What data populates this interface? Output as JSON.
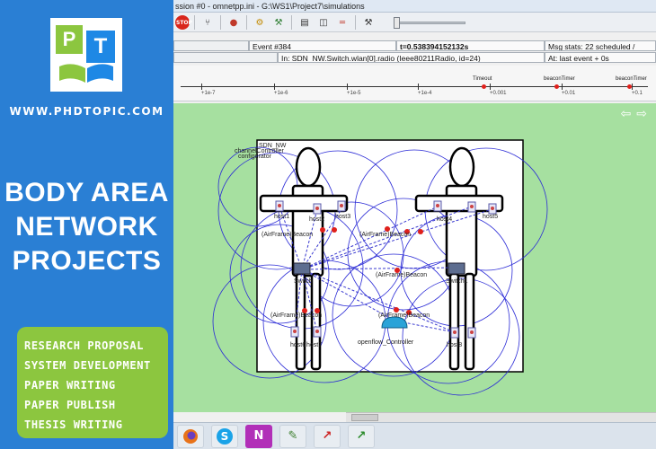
{
  "promo": {
    "logo_p": "P",
    "logo_t": "T",
    "website": "WWW.PHDTOPIC.COM",
    "title_lines": [
      "BODY AREA",
      "NETWORK",
      "PROJECTS"
    ],
    "services": [
      "RESEARCH PROPOSAL",
      "SYSTEM DEVELOPMENT",
      "PAPER WRITING",
      "PAPER PUBLISH",
      "THESIS WRITING"
    ],
    "colors": {
      "panel": "#2a7fd4",
      "green": "#8cc63f"
    }
  },
  "window": {
    "title": "ssion #0 - omnetpp.ini - G:\\WS1\\Project7\\simulations",
    "toolbar_icons": [
      "stop-icon",
      "step-icon",
      "record-icon",
      "run-icon",
      "fast-run-icon",
      "view-module-icon",
      "view-split-icon",
      "timeline-icon",
      "wrench-icon"
    ],
    "stop_label": "STOP",
    "rec_label": "REC",
    "event_label": "Event #384",
    "time_label": "t=0.538394152132s",
    "msg_stats": "Msg stats: 22 scheduled /",
    "module_path": "In: SDN_NW.Switch.wlan[0].radio (Ieee80211Radio, id=24)",
    "last_event": "At: last event + 0s",
    "timeline": {
      "events": [
        "Timeout",
        "beaconTimer",
        "beaconTimer"
      ],
      "scale_labels": [
        "+1e-7",
        "+1e-6",
        "+1e-5",
        "+1e-4",
        "+0.001",
        "+0.01",
        "+0.1"
      ]
    },
    "nav_arrows": "⇦⇨"
  },
  "network": {
    "name": "SDN_NW",
    "bg_label": "channelController",
    "config_label": "configurator",
    "hosts": [
      "host1",
      "host2",
      "host3",
      "host4",
      "host5",
      "host6",
      "host7",
      "host8"
    ],
    "beacon_label": "(AirFrame)Beacon",
    "switch1": "Switch",
    "switch2": "Switch1",
    "controller": "openflow_Controller"
  },
  "taskbar": {
    "apps": [
      "firefox-icon",
      "skype-icon",
      "netbeans-icon",
      "editor-icon",
      "arrow-tool-icon",
      "arrow-tool-2-icon"
    ],
    "skype_letter": "S",
    "nm_letter": "N"
  }
}
